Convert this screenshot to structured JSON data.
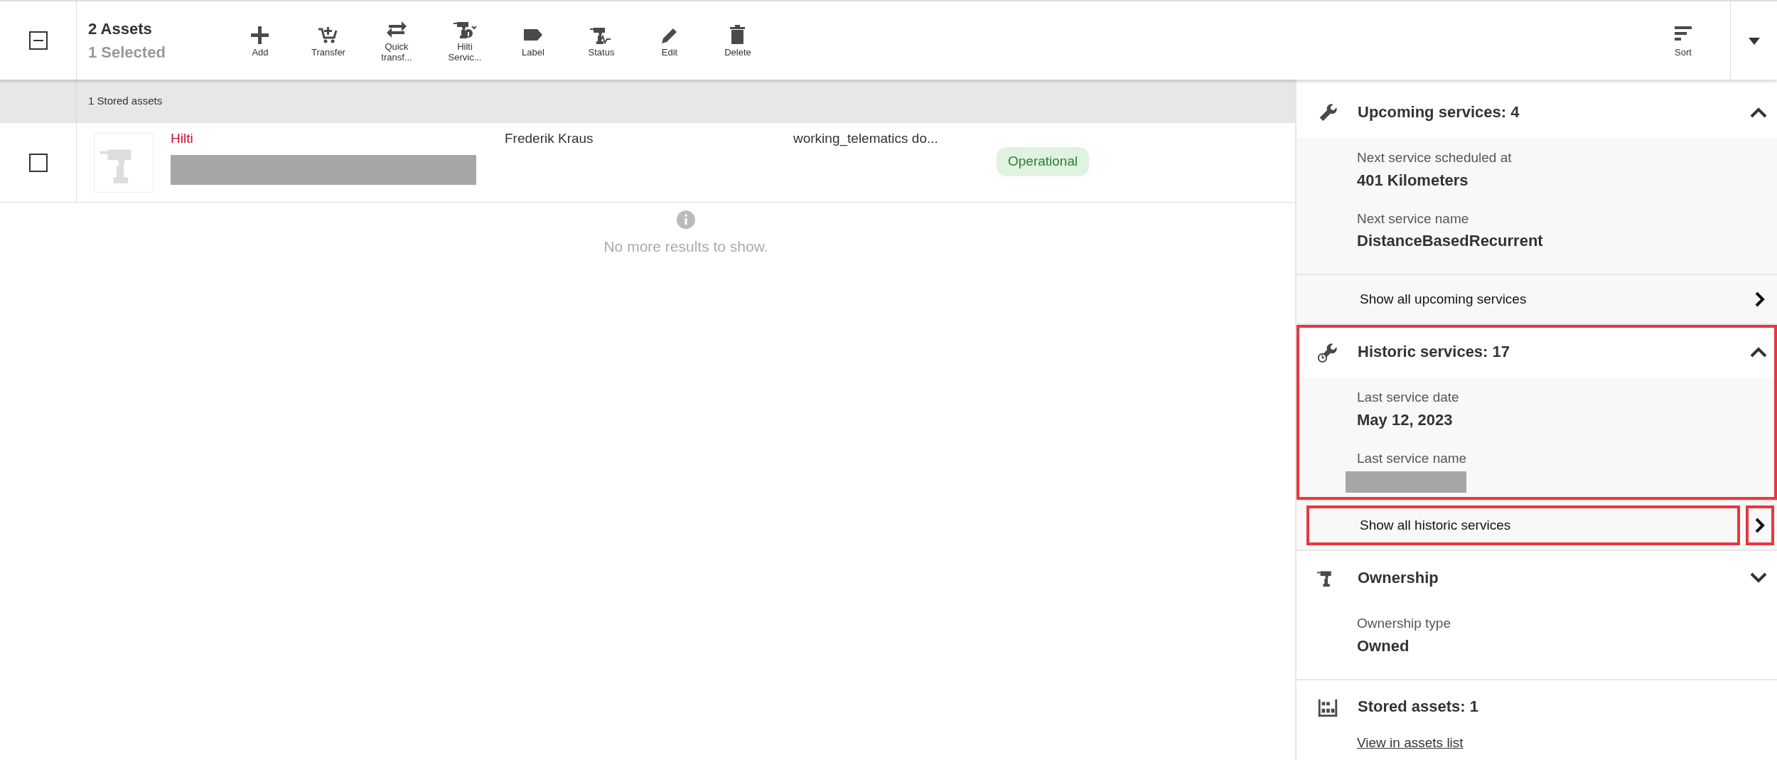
{
  "toolbar": {
    "select_all": {
      "indeterminate": true
    },
    "title": "2 Assets",
    "selection": "1 Selected",
    "actions": [
      {
        "label": "Add"
      },
      {
        "label": "Transfer"
      },
      {
        "label": "Quick transf..."
      },
      {
        "label": "Hilti Servic..."
      },
      {
        "label": "Label"
      },
      {
        "label": "Status"
      },
      {
        "label": "Edit"
      },
      {
        "label": "Delete"
      }
    ],
    "sort": {
      "label": "Sort"
    }
  },
  "asset_list": {
    "group_label": "1 Stored assets",
    "rows": [
      {
        "checked": false,
        "name": "Hilti",
        "name_detail_redacted": true,
        "person": "Frederik Kraus",
        "column_4": "working_telematics do...",
        "status": "Operational"
      }
    ],
    "end_message": "No more results to show."
  },
  "detail_panel": {
    "sections": [
      {
        "kind": "upcoming",
        "title": "Upcoming services: 4",
        "expanded": true,
        "highlighted": false,
        "fields": [
          {
            "label": "Next service scheduled at",
            "value": "401 Kilometers"
          },
          {
            "label": "Next service name",
            "value": "DistanceBasedRecurrent"
          }
        ],
        "link": {
          "label": "Show all upcoming services",
          "highlighted": false
        }
      },
      {
        "kind": "historic",
        "title": "Historic services: 17",
        "expanded": true,
        "highlighted": true,
        "fields": [
          {
            "label": "Last service date",
            "value": "May 12, 2023"
          },
          {
            "label": "Last service name",
            "redacted": true
          }
        ],
        "link": {
          "label": "Show all historic services",
          "highlighted": true
        }
      },
      {
        "kind": "ownership",
        "title": "Ownership",
        "expanded": false,
        "highlighted": false,
        "fields": [
          {
            "label": "Ownership type",
            "value": "Owned"
          }
        ]
      },
      {
        "kind": "stored",
        "title": "Stored assets: 1",
        "highlighted": false,
        "footer_link": "View in assets list"
      }
    ]
  }
}
